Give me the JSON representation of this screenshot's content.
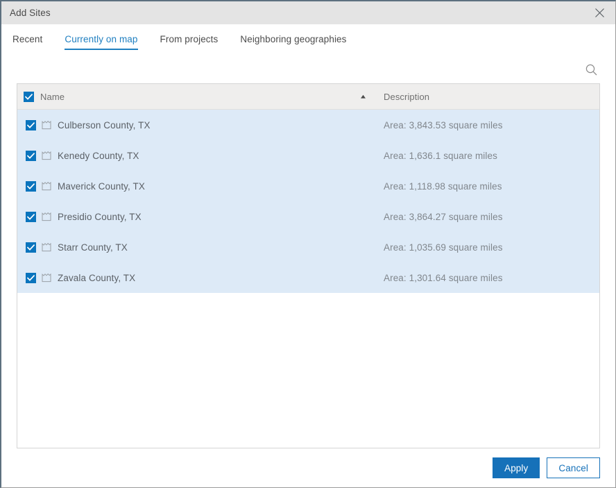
{
  "window": {
    "title": "Add Sites",
    "close_icon": "close-icon"
  },
  "tabs": [
    {
      "label": "Recent",
      "active": false
    },
    {
      "label": "Currently on map",
      "active": true
    },
    {
      "label": "From projects",
      "active": false
    },
    {
      "label": "Neighboring geographies",
      "active": false
    }
  ],
  "search": {
    "icon": "search-icon"
  },
  "table": {
    "select_all_checked": true,
    "columns": [
      {
        "key": "name",
        "label": "Name",
        "sort": "ascending",
        "sort_icon": "triangle-up-icon"
      },
      {
        "key": "description",
        "label": "Description",
        "sort": "none"
      }
    ],
    "rows": [
      {
        "checked": true,
        "icon": "polygon-feature-icon",
        "name": "Culberson County, TX",
        "description": "Area: 3,843.53 square miles"
      },
      {
        "checked": true,
        "icon": "polygon-feature-icon",
        "name": "Kenedy County, TX",
        "description": "Area: 1,636.1 square miles"
      },
      {
        "checked": true,
        "icon": "polygon-feature-icon",
        "name": "Maverick County, TX",
        "description": "Area: 1,118.98 square miles"
      },
      {
        "checked": true,
        "icon": "polygon-feature-icon",
        "name": "Presidio County, TX",
        "description": "Area: 3,864.27 square miles"
      },
      {
        "checked": true,
        "icon": "polygon-feature-icon",
        "name": "Starr County, TX",
        "description": "Area: 1,035.69 square miles"
      },
      {
        "checked": true,
        "icon": "polygon-feature-icon",
        "name": "Zavala County, TX",
        "description": "Area: 1,301.64 square miles"
      }
    ]
  },
  "footer": {
    "apply_label": "Apply",
    "cancel_label": "Cancel"
  },
  "colors": {
    "accent": "#1671b9",
    "tab_active": "#1f7fc0",
    "checkbox_fill": "#0a74bd",
    "row_selected_bg": "#ddeaf7",
    "header_bg": "#efeeed",
    "titlebar_bg": "#e4e4e4",
    "window_border": "#5d707f"
  }
}
